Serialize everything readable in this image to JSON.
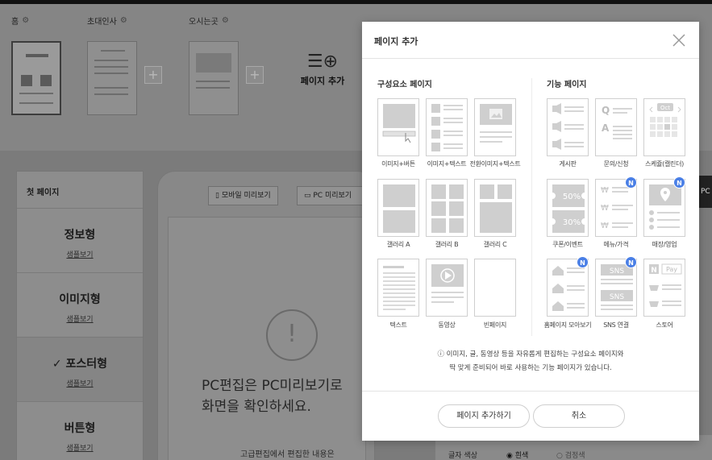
{
  "pages": [
    {
      "name": "홈",
      "active": true
    },
    {
      "name": "초대인사",
      "active": false
    },
    {
      "name": "오시는곳",
      "active": false
    }
  ],
  "add_page_label": "페이지 추가",
  "sidebar": {
    "title": "첫 페이지",
    "items": [
      {
        "title": "정보형",
        "link": "샘플보기"
      },
      {
        "title": "이미지형",
        "link": "샘플보기"
      },
      {
        "title": "포스터형",
        "link": "샘플보기",
        "checked": true
      },
      {
        "title": "버튼형",
        "link": "샘플보기"
      }
    ]
  },
  "preview": {
    "mobile_label": "모바일 미리보기",
    "pc_label": "PC 미리보기",
    "message_line1": "PC편집은 PC미리보기로",
    "message_line2": "화면을 확인하세요.",
    "sub": "고급편집에서 편집한 내용은"
  },
  "right_panel": {
    "label": "글자 색상",
    "opt1": "흰색",
    "opt2": "검정색",
    "tab": "PC"
  },
  "modal": {
    "title": "페이지 추가",
    "component_title": "구성요소 페이지",
    "feature_title": "기능 페이지",
    "components": [
      {
        "label": "이미지+버튼"
      },
      {
        "label": "이미지+텍스트"
      },
      {
        "label": "전환이미지+텍스트"
      },
      {
        "label": "갤러리 A"
      },
      {
        "label": "갤러리 B"
      },
      {
        "label": "갤러리 C"
      },
      {
        "label": "텍스트"
      },
      {
        "label": "동영상"
      },
      {
        "label": "빈페이지"
      }
    ],
    "features": [
      {
        "label": "게시판",
        "new": false
      },
      {
        "label": "문의/신청",
        "new": false
      },
      {
        "label": "스케쥴(캘린더)",
        "new": false
      },
      {
        "label": "쿠폰/이벤트",
        "new": false
      },
      {
        "label": "메뉴/가격",
        "new": true
      },
      {
        "label": "매장/영업",
        "new": true
      },
      {
        "label": "홈페이지 모아보기",
        "new": true
      },
      {
        "label": "SNS 연결",
        "new": true
      },
      {
        "label": "스토어",
        "new": false
      }
    ],
    "card_text": {
      "q": "Q",
      "a": "A",
      "oct": "Oct",
      "c50": "50%",
      "c30": "30%",
      "won": "₩",
      "sns": "SNS",
      "n": "N",
      "pay": "Pay"
    },
    "badge_text": "N",
    "info_line1": "ⓘ 이미지, 글, 동영상 등을 자유롭게 편집하는 구성요소 페이지와",
    "info_line2": "딱 맞게 준비되어 바로 사용하는 기능 페이지가 있습니다.",
    "add_button": "페이지 추가하기",
    "cancel_button": "취소"
  }
}
